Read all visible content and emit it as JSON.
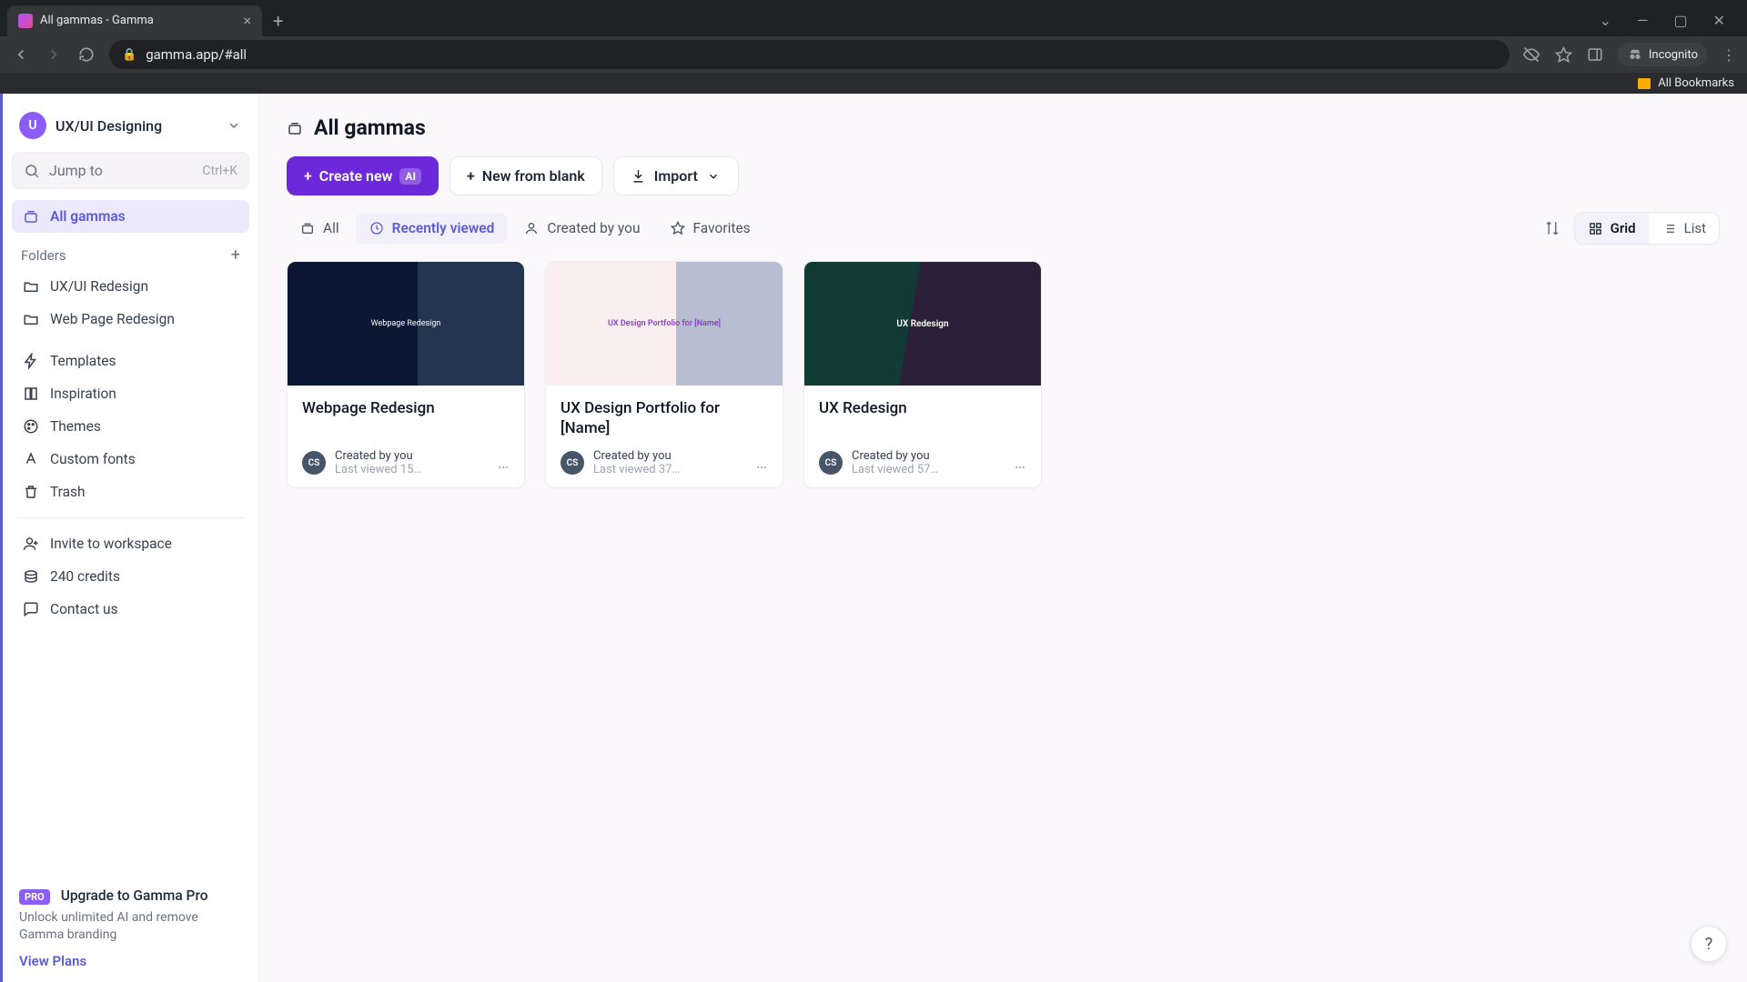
{
  "browser": {
    "tab_title": "All gammas - Gamma",
    "url": "gamma.app/#all",
    "incognito_label": "Incognito",
    "bookmarks_label": "All Bookmarks"
  },
  "workspace": {
    "avatar_initial": "U",
    "name": "UX/UI Designing"
  },
  "search": {
    "placeholder": "Jump to",
    "shortcut": "Ctrl+K"
  },
  "sidebar": {
    "all_gammas": "All gammas",
    "folders_label": "Folders",
    "folders": [
      {
        "label": "UX/UI Redesign"
      },
      {
        "label": "Web Page Redesign"
      }
    ],
    "links": {
      "templates": "Templates",
      "inspiration": "Inspiration",
      "themes": "Themes",
      "custom_fonts": "Custom fonts",
      "trash": "Trash",
      "invite": "Invite to workspace",
      "credits": "240 credits",
      "contact": "Contact us"
    },
    "upgrade": {
      "badge": "PRO",
      "title": "Upgrade to Gamma Pro",
      "subtitle": "Unlock unlimited AI and remove Gamma branding",
      "cta": "View Plans"
    }
  },
  "page": {
    "title": "All gammas"
  },
  "actions": {
    "create": "Create new",
    "ai_chip": "AI",
    "blank": "New from blank",
    "import": "Import"
  },
  "filters": {
    "all": "All",
    "recent": "Recently viewed",
    "created": "Created by you",
    "favorites": "Favorites"
  },
  "view": {
    "grid": "Grid",
    "list": "List"
  },
  "cards": [
    {
      "title": "Webpage Redesign",
      "creator": "Created by you",
      "viewed": "Last viewed 15…",
      "avatar": "CS",
      "thumb_label": "Webpage Redesign"
    },
    {
      "title": "UX Design Portfolio for [Name]",
      "creator": "Created by you",
      "viewed": "Last viewed 37…",
      "avatar": "CS",
      "thumb_label": "UX Design Portfolio for [Name]"
    },
    {
      "title": "UX Redesign",
      "creator": "Created by you",
      "viewed": "Last viewed 57…",
      "avatar": "CS",
      "thumb_label": "UX Redesign"
    }
  ],
  "help": "?"
}
